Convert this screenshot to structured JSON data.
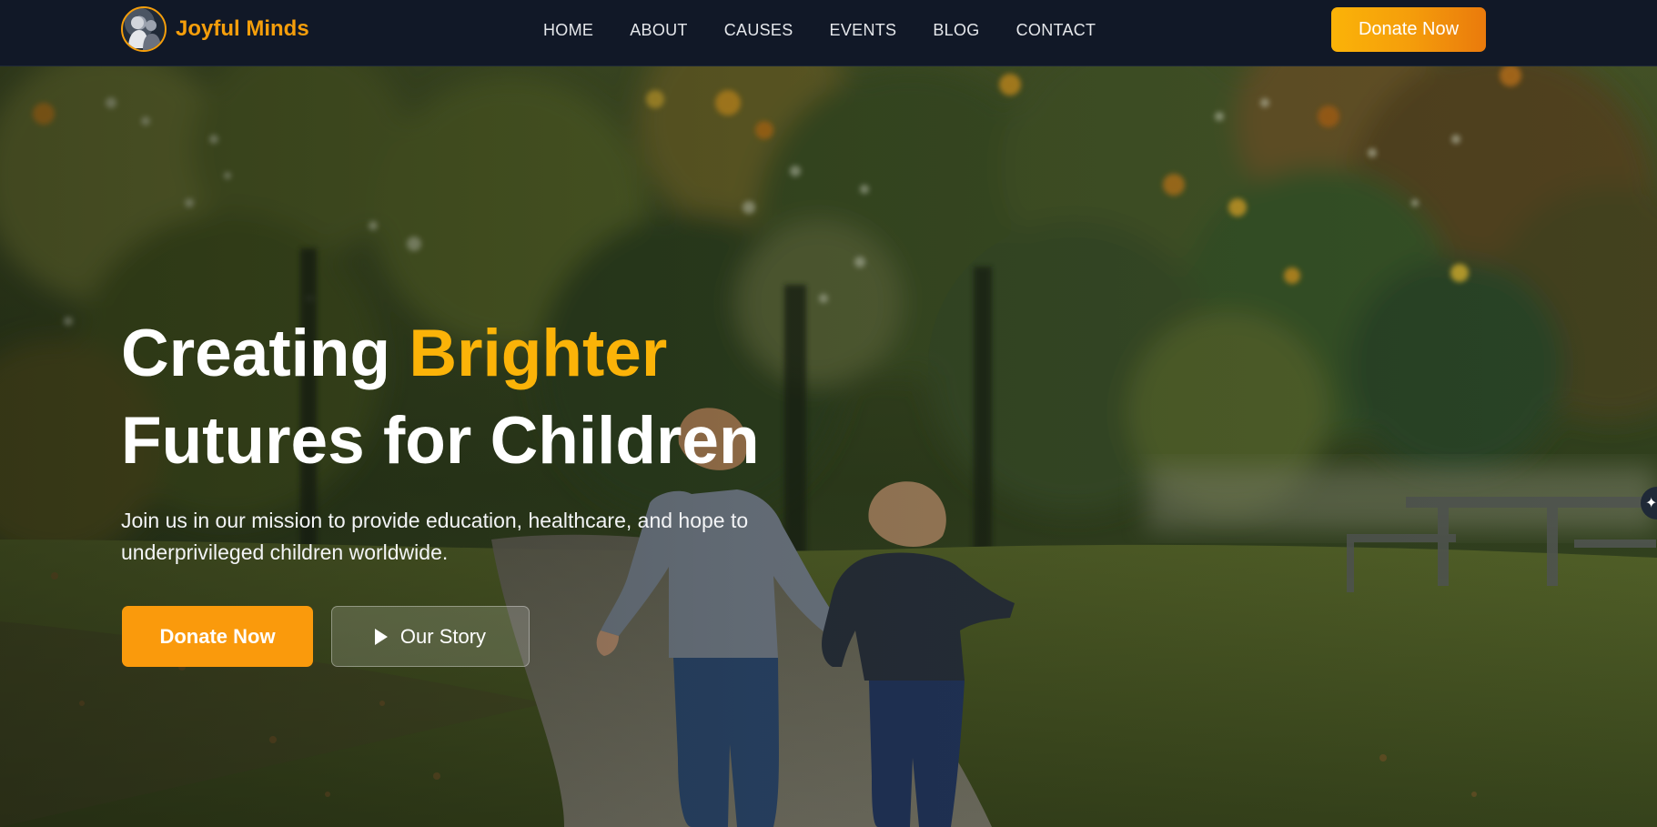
{
  "header": {
    "brand_name": "Joyful Minds",
    "nav": [
      {
        "label": "HOME"
      },
      {
        "label": "ABOUT"
      },
      {
        "label": "CAUSES"
      },
      {
        "label": "EVENTS"
      },
      {
        "label": "BLOG"
      },
      {
        "label": "CONTACT"
      }
    ],
    "donate_label": "Donate Now"
  },
  "hero": {
    "title_part1": "Creating ",
    "title_accent": "Brighter",
    "title_part2": "Futures for Children",
    "subtitle": "Join us in our mission to provide education, healthcare, and hope to underprivileged children worldwide.",
    "primary_button": "Donate Now",
    "secondary_button": "Our Story",
    "background_image": "two children walking hand in hand on a park path"
  },
  "colors": {
    "nav_bg": "#111827",
    "accent": "#fbb308",
    "primary_button": "#fa9a0c",
    "brand_text": "#f59e0b"
  },
  "icons": {
    "play": "play-icon",
    "logo": "logo-avatar-icon",
    "side_widget": "sparkle-icon"
  }
}
